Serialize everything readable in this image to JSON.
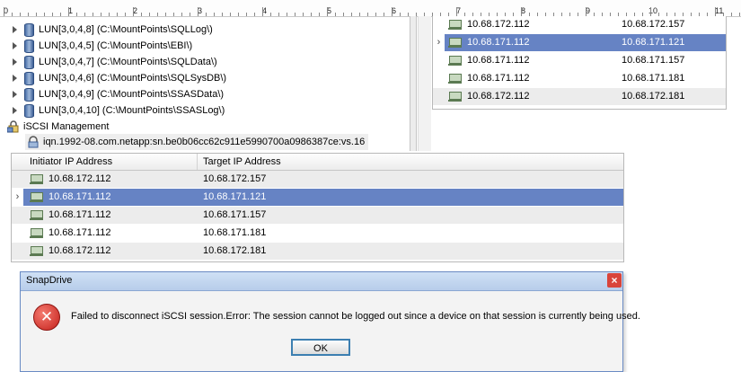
{
  "ruler": {
    "numbers": [
      "0",
      "1",
      "2",
      "3",
      "4",
      "5",
      "6",
      "7",
      "8",
      "9",
      "10",
      "11"
    ]
  },
  "tree": {
    "luns": [
      {
        "label": "LUN[3,0,4,8] (C:\\MountPoints\\SQLLog\\)"
      },
      {
        "label": "LUN[3,0,4,5] (C:\\MountPoints\\EBI\\)"
      },
      {
        "label": "LUN[3,0,4,7] (C:\\MountPoints\\SQLData\\)"
      },
      {
        "label": "LUN[3,0,4,6] (C:\\MountPoints\\SQLSysDB\\)"
      },
      {
        "label": "LUN[3,0,4,9] (C:\\MountPoints\\SSASData\\)"
      },
      {
        "label": "LUN[3,0,4,10] (C:\\MountPoints\\SSASLog\\)"
      }
    ],
    "iscsi_management": "iSCSI Management",
    "iqn": "iqn.1992-08.com.netapp:sn.be0b06cc62c911e5990700a0986387ce:vs.16"
  },
  "grid_top": {
    "rows": [
      {
        "initiator": "10.68.172.112",
        "target": "10.68.172.157",
        "selected": false
      },
      {
        "initiator": "10.68.171.112",
        "target": "10.68.171.121",
        "selected": true
      },
      {
        "initiator": "10.68.171.112",
        "target": "10.68.171.157",
        "selected": false
      },
      {
        "initiator": "10.68.171.112",
        "target": "10.68.171.181",
        "selected": false
      },
      {
        "initiator": "10.68.172.112",
        "target": "10.68.172.181",
        "selected": false
      }
    ]
  },
  "grid_main": {
    "columns": [
      "Initiator IP Address",
      "Target IP Address"
    ],
    "rows": [
      {
        "initiator": "10.68.172.112",
        "target": "10.68.172.157",
        "selected": false
      },
      {
        "initiator": "10.68.171.112",
        "target": "10.68.171.121",
        "selected": true
      },
      {
        "initiator": "10.68.171.112",
        "target": "10.68.171.157",
        "selected": false
      },
      {
        "initiator": "10.68.171.112",
        "target": "10.68.171.181",
        "selected": false
      },
      {
        "initiator": "10.68.172.112",
        "target": "10.68.172.181",
        "selected": false
      }
    ]
  },
  "dialog": {
    "title": "SnapDrive",
    "close_glyph": "×",
    "error_glyph": "✕",
    "message": "Failed to disconnect iSCSI session.Error: The session cannot be logged out since a device on that session is currently being used.",
    "ok_label": "OK"
  },
  "icons": {
    "disk": "disk-icon",
    "host": "network-host-icon",
    "iscsi": "iscsi-icon",
    "error": "error-icon"
  },
  "colors": {
    "selection": "#6683c4",
    "dialog_border": "#6a8bc4",
    "error": "#c5201b"
  }
}
